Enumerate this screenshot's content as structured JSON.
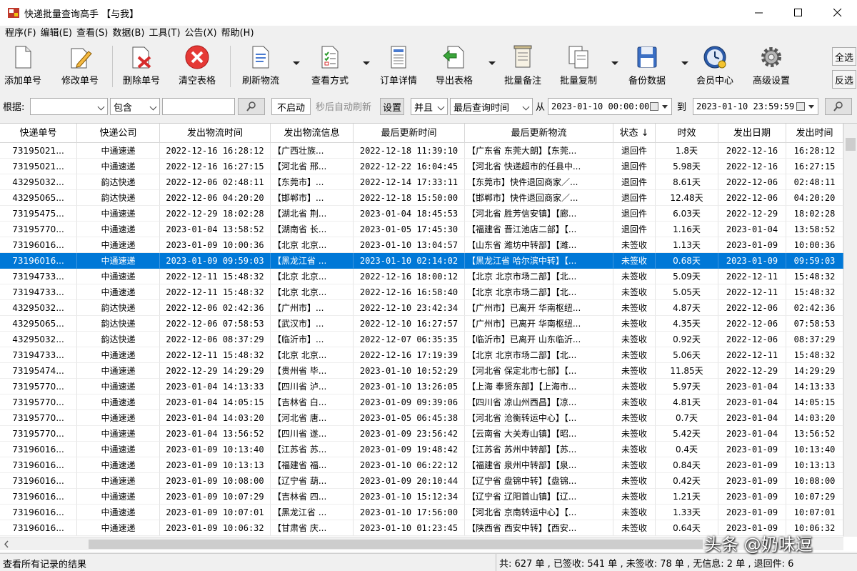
{
  "window": {
    "title": "快递批量查询高手 【与我】"
  },
  "menu": [
    "程序(F)",
    "编辑(E)",
    "查看(S)",
    "数据(B)",
    "工具(T)",
    "公告(X)",
    "帮助(H)"
  ],
  "toolbar": {
    "add": "添加单号",
    "edit": "修改单号",
    "delete": "删除单号",
    "clear": "清空表格",
    "refresh": "刷新物流",
    "view_mode": "查看方式",
    "order_detail": "订单详情",
    "export": "导出表格",
    "batch_note": "批量备注",
    "batch_copy": "批量复制",
    "backup": "备份数据",
    "member": "会员中心",
    "advanced": "高级设置",
    "select_all": "全选",
    "invert": "反选"
  },
  "filter": {
    "label": "根据:",
    "field_value": "",
    "match": "包含",
    "keyword": "",
    "auto_btn": "不启动",
    "auto_hint": "秒后自动刷新",
    "settings": "设置",
    "logic": "并且",
    "time_field": "最后查询时间",
    "from_label": "从",
    "from": "2023-01-10 00:00:00",
    "to_label": "到",
    "to": "2023-01-10 23:59:59"
  },
  "columns": [
    "快递单号",
    "快递公司",
    "发出物流时间",
    "发出物流信息",
    "最后更新时间",
    "最后更新物流",
    "状态 ↓",
    "时效",
    "发出日期",
    "发出时间"
  ],
  "rows": [
    [
      "73195021...",
      "中通速递",
      "2022-12-16 16:28:12",
      "【广西壮族...",
      "2022-12-18 11:39:10",
      "【广东省 东莞大朗】【东莞...",
      "退回件",
      "1.8天",
      "2022-12-16",
      "16:28:12"
    ],
    [
      "73195021...",
      "中通速递",
      "2022-12-16 16:27:15",
      "【河北省 邢...",
      "2022-12-22 16:04:45",
      "【河北省 快递超市的任县中...",
      "退回件",
      "5.98天",
      "2022-12-16",
      "16:27:15"
    ],
    [
      "43295032...",
      "韵达快递",
      "2022-12-06 02:48:11",
      "【东莞市】...",
      "2022-12-14 17:33:11",
      "【东莞市】快件退回商家／...",
      "退回件",
      "8.61天",
      "2022-12-06",
      "02:48:11"
    ],
    [
      "43295065...",
      "韵达快递",
      "2022-12-06 04:20:20",
      "【邯郸市】...",
      "2022-12-18 15:50:00",
      "【邯郸市】快件退回商家／...",
      "退回件",
      "12.48天",
      "2022-12-06",
      "04:20:20"
    ],
    [
      "73195475...",
      "中通速递",
      "2022-12-29 18:02:28",
      "【湖北省 荆...",
      "2023-01-04 18:45:53",
      "【河北省 胜芳信安镇】【廊...",
      "退回件",
      "6.03天",
      "2022-12-29",
      "18:02:28"
    ],
    [
      "73195770...",
      "中通速递",
      "2023-01-04 13:58:52",
      "【湖南省 长...",
      "2023-01-05 17:45:30",
      "【福建省 晋江池店二部】【...",
      "退回件",
      "1.16天",
      "2023-01-04",
      "13:58:52"
    ],
    [
      "73196016...",
      "中通速递",
      "2023-01-09 10:00:36",
      "【北京 北京...",
      "2023-01-10 13:04:57",
      "【山东省 潍坊中转部】【潍...",
      "未签收",
      "1.13天",
      "2023-01-09",
      "10:00:36"
    ],
    [
      "73196016...",
      "中通速递",
      "2023-01-09 09:59:03",
      "【黑龙江省 ...",
      "2023-01-10 02:14:02",
      "【黑龙江省 哈尔滨中转】【...",
      "未签收",
      "0.68天",
      "2023-01-09",
      "09:59:03"
    ],
    [
      "73194733...",
      "中通速递",
      "2022-12-11 15:48:32",
      "【北京 北京...",
      "2022-12-16 18:00:12",
      "【北京 北京市场二部】【北...",
      "未签收",
      "5.09天",
      "2022-12-11",
      "15:48:32"
    ],
    [
      "73194733...",
      "中通速递",
      "2022-12-11 15:48:32",
      "【北京 北京...",
      "2022-12-16 16:58:40",
      "【北京 北京市场二部】【北...",
      "未签收",
      "5.05天",
      "2022-12-11",
      "15:48:32"
    ],
    [
      "43295032...",
      "韵达快递",
      "2022-12-06 02:42:36",
      "【广州市】...",
      "2022-12-10 23:42:34",
      "【广州市】已离开 华南枢纽...",
      "未签收",
      "4.87天",
      "2022-12-06",
      "02:42:36"
    ],
    [
      "43295065...",
      "韵达快递",
      "2022-12-06 07:58:53",
      "【武汉市】...",
      "2022-12-10 16:27:57",
      "【广州市】已离开 华南枢纽...",
      "未签收",
      "4.35天",
      "2022-12-06",
      "07:58:53"
    ],
    [
      "43295032...",
      "韵达快递",
      "2022-12-06 08:37:29",
      "【临沂市】...",
      "2022-12-07 06:35:35",
      "【临沂市】已离开 山东临沂...",
      "未签收",
      "0.92天",
      "2022-12-06",
      "08:37:29"
    ],
    [
      "73194733...",
      "中通速递",
      "2022-12-11 15:48:32",
      "【北京 北京...",
      "2022-12-16 17:19:39",
      "【北京 北京市场二部】【北...",
      "未签收",
      "5.06天",
      "2022-12-11",
      "15:48:32"
    ],
    [
      "73195474...",
      "中通速递",
      "2022-12-29 14:29:29",
      "【贵州省 毕...",
      "2023-01-10 10:52:29",
      "【河北省 保定北市七部】【...",
      "未签收",
      "11.85天",
      "2022-12-29",
      "14:29:29"
    ],
    [
      "73195770...",
      "中通速递",
      "2023-01-04 14:13:33",
      "【四川省 泸...",
      "2023-01-10 13:26:05",
      "【上海 奉贤东部】【上海市...",
      "未签收",
      "5.97天",
      "2023-01-04",
      "14:13:33"
    ],
    [
      "73195770...",
      "中通速递",
      "2023-01-04 14:05:15",
      "【吉林省 白...",
      "2023-01-09 09:39:06",
      "【四川省 凉山州西昌】【凉...",
      "未签收",
      "4.81天",
      "2023-01-04",
      "14:05:15"
    ],
    [
      "73195770...",
      "中通速递",
      "2023-01-04 14:03:20",
      "【河北省 唐...",
      "2023-01-05 06:45:38",
      "【河北省 沧衡转运中心】【...",
      "未签收",
      "0.7天",
      "2023-01-04",
      "14:03:20"
    ],
    [
      "73195770...",
      "中通速递",
      "2023-01-04 13:56:52",
      "【四川省 遂...",
      "2023-01-09 23:56:42",
      "【云南省 大关寿山镇】【昭...",
      "未签收",
      "5.42天",
      "2023-01-04",
      "13:56:52"
    ],
    [
      "73196016...",
      "中通速递",
      "2023-01-09 10:13:40",
      "【江苏省 苏...",
      "2023-01-09 19:48:42",
      "【江苏省 苏州中转部】【苏...",
      "未签收",
      "0.4天",
      "2023-01-09",
      "10:13:40"
    ],
    [
      "73196016...",
      "中通速递",
      "2023-01-09 10:13:13",
      "【福建省 福...",
      "2023-01-10 06:22:12",
      "【福建省 泉州中转部】【泉...",
      "未签收",
      "0.84天",
      "2023-01-09",
      "10:13:13"
    ],
    [
      "73196016...",
      "中通速递",
      "2023-01-09 10:08:00",
      "【辽宁省 葫...",
      "2023-01-09 20:10:44",
      "【辽宁省 盘锦中转】【盘锦...",
      "未签收",
      "0.42天",
      "2023-01-09",
      "10:08:00"
    ],
    [
      "73196016...",
      "中通速递",
      "2023-01-09 10:07:29",
      "【吉林省 四...",
      "2023-01-10 15:12:34",
      "【辽宁省 辽阳首山镇】【辽...",
      "未签收",
      "1.21天",
      "2023-01-09",
      "10:07:29"
    ],
    [
      "73196016...",
      "中通速递",
      "2023-01-09 10:07:01",
      "【黑龙江省 ...",
      "2023-01-10 17:56:00",
      "【河北省 京南转运中心】【...",
      "未签收",
      "1.33天",
      "2023-01-09",
      "10:07:01"
    ],
    [
      "73196016...",
      "中通速递",
      "2023-01-09 10:06:32",
      "【甘肃省 庆...",
      "2023-01-10 01:23:45",
      "【陕西省 西安中转】【西安...",
      "未签收",
      "0.64天",
      "2023-01-09",
      "10:06:32"
    ]
  ],
  "status": {
    "left": "查看所有记录的结果",
    "right": "共: 627 单 , 已签收:  541 单 , 未签收:  78 单 , 无信息: 2 单 , 退回件: 6"
  },
  "watermark": "头条 @奶味逗",
  "colors": {
    "selection": "#0078d7"
  }
}
